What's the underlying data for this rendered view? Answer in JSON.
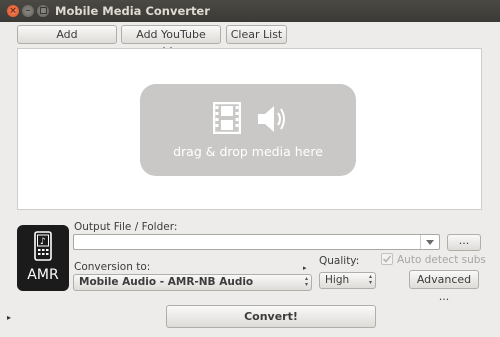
{
  "window": {
    "title": "Mobile Media Converter",
    "close_glyph": "×",
    "min_glyph": "–"
  },
  "toolbar": {
    "add": "Add",
    "add_youtube": "Add YouTube video",
    "clear_list": "Clear List"
  },
  "dropzone": {
    "text": "drag & drop media here",
    "icons": [
      "film-icon",
      "speaker-icon"
    ]
  },
  "output": {
    "label": "Output File / Folder:",
    "value": "",
    "browse": "..."
  },
  "format_icon": {
    "text": "AMR",
    "icon": "music-phone-icon"
  },
  "conversion": {
    "label": "Conversion to:",
    "selected": "Mobile Audio - AMR-NB Audio"
  },
  "quality": {
    "label": "Quality:",
    "selected": "High"
  },
  "auto_detect_subs": {
    "label": "Auto detect subs",
    "checked": true,
    "enabled": false
  },
  "advanced_button": "Advanced ...",
  "convert_button": "Convert!",
  "expander_glyph": "▸"
}
